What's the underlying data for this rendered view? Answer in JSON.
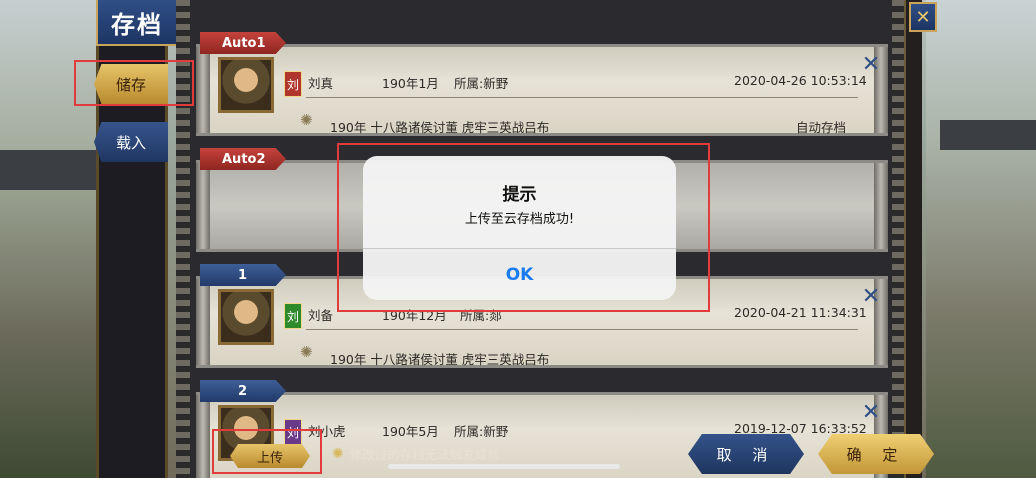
{
  "sidebar": {
    "title": "存档",
    "tabs": [
      {
        "label": "储存",
        "active": true
      },
      {
        "label": "载入",
        "active": false
      }
    ]
  },
  "slots": [
    {
      "tag": "Auto1",
      "faction": "刘",
      "faction_color": "#b0352c",
      "name": "刘真",
      "date": "190年1月",
      "affiliation": "所属:新野",
      "saved_at": "2020-04-26  10:53:14",
      "scenario": "190年   十八路诸侯讨董  虎牢三英战吕布",
      "note": "自动存档"
    },
    {
      "tag": "Auto2",
      "empty": true
    },
    {
      "tag": "1",
      "faction": "刘",
      "faction_color": "#2f8a2c",
      "name": "刘备",
      "date": "190年12月",
      "affiliation": "所属:郯",
      "saved_at": "2020-04-21   11:34:31",
      "scenario": "190年   十八路诸侯讨董  虎牢三英战吕布",
      "note": ""
    },
    {
      "tag": "2",
      "faction": "刘",
      "faction_color": "#6a3a8a",
      "name": "刘小虎",
      "date": "190年5月",
      "affiliation": "所属:新野",
      "saved_at": "2019-12-07   16:33:52",
      "scenario": "",
      "note": ""
    }
  ],
  "bottom": {
    "upload_label": "上传",
    "hint": "修改过的存档无法触发成就",
    "cancel_label": "取 消",
    "confirm_label": "确 定"
  },
  "dialog": {
    "title": "提示",
    "message": "上传至云存档成功!",
    "ok_label": "OK"
  },
  "icons": {
    "close": "close-x-icon",
    "gear": "gear-icon",
    "fan": "fan-icon"
  }
}
